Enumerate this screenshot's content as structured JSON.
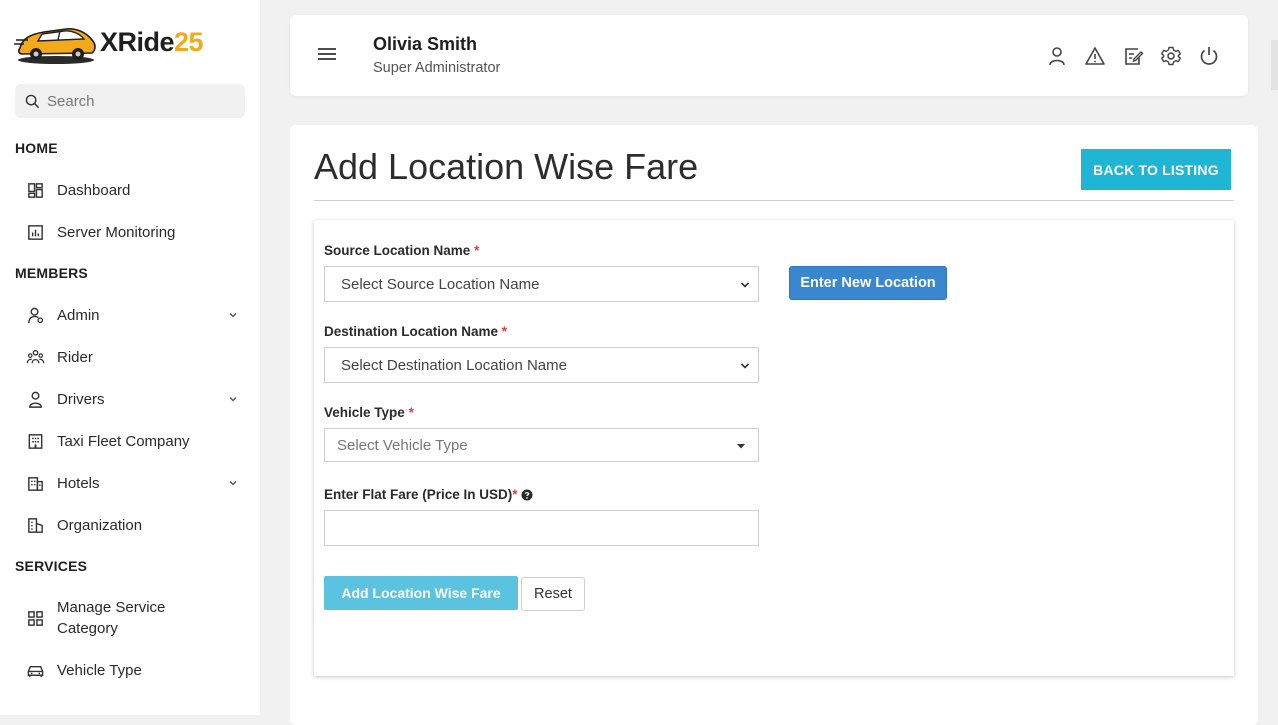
{
  "brand": {
    "name_part1": "XRide",
    "name_part2": "25",
    "accent": "#f2a91b"
  },
  "search": {
    "placeholder": "Search"
  },
  "sidebar": {
    "sections": [
      "HOME",
      "MEMBERS",
      "SERVICES"
    ],
    "items": [
      {
        "label": "Dashboard",
        "icon": "dashboard-icon"
      },
      {
        "label": "Server Monitoring",
        "icon": "chart-icon"
      },
      {
        "label": "Admin",
        "icon": "admin-icon",
        "expandable": true
      },
      {
        "label": "Rider",
        "icon": "users-icon"
      },
      {
        "label": "Drivers",
        "icon": "driver-icon",
        "expandable": true
      },
      {
        "label": "Taxi Fleet Company",
        "icon": "building-icon"
      },
      {
        "label": "Hotels",
        "icon": "hotel-icon",
        "expandable": true
      },
      {
        "label": "Organization",
        "icon": "organization-icon"
      },
      {
        "label": "Manage Service Category",
        "icon": "grid-icon"
      },
      {
        "label": "Vehicle Type",
        "icon": "car-icon"
      }
    ]
  },
  "header": {
    "user_name": "Olivia Smith",
    "user_role": "Super Administrator",
    "icons": [
      "profile-icon",
      "alert-icon",
      "edit-icon",
      "settings-icon",
      "power-icon"
    ]
  },
  "page": {
    "title": "Add Location Wise Fare",
    "back_label": "BACK TO LISTING",
    "accent": "#1fb6d6"
  },
  "form": {
    "source_label": "Source Location Name",
    "source_value": "Select Source Location Name",
    "new_location_label": "Enter New Location",
    "destination_label": "Destination Location Name",
    "destination_value": "Select Destination Location Name",
    "vehicle_label": "Vehicle Type",
    "vehicle_value": "Select Vehicle Type",
    "fare_label": "Enter Flat Fare (Price In USD)",
    "fare_value": "",
    "required_mark": "*",
    "submit_label": "Add Location Wise Fare",
    "reset_label": "Reset"
  }
}
